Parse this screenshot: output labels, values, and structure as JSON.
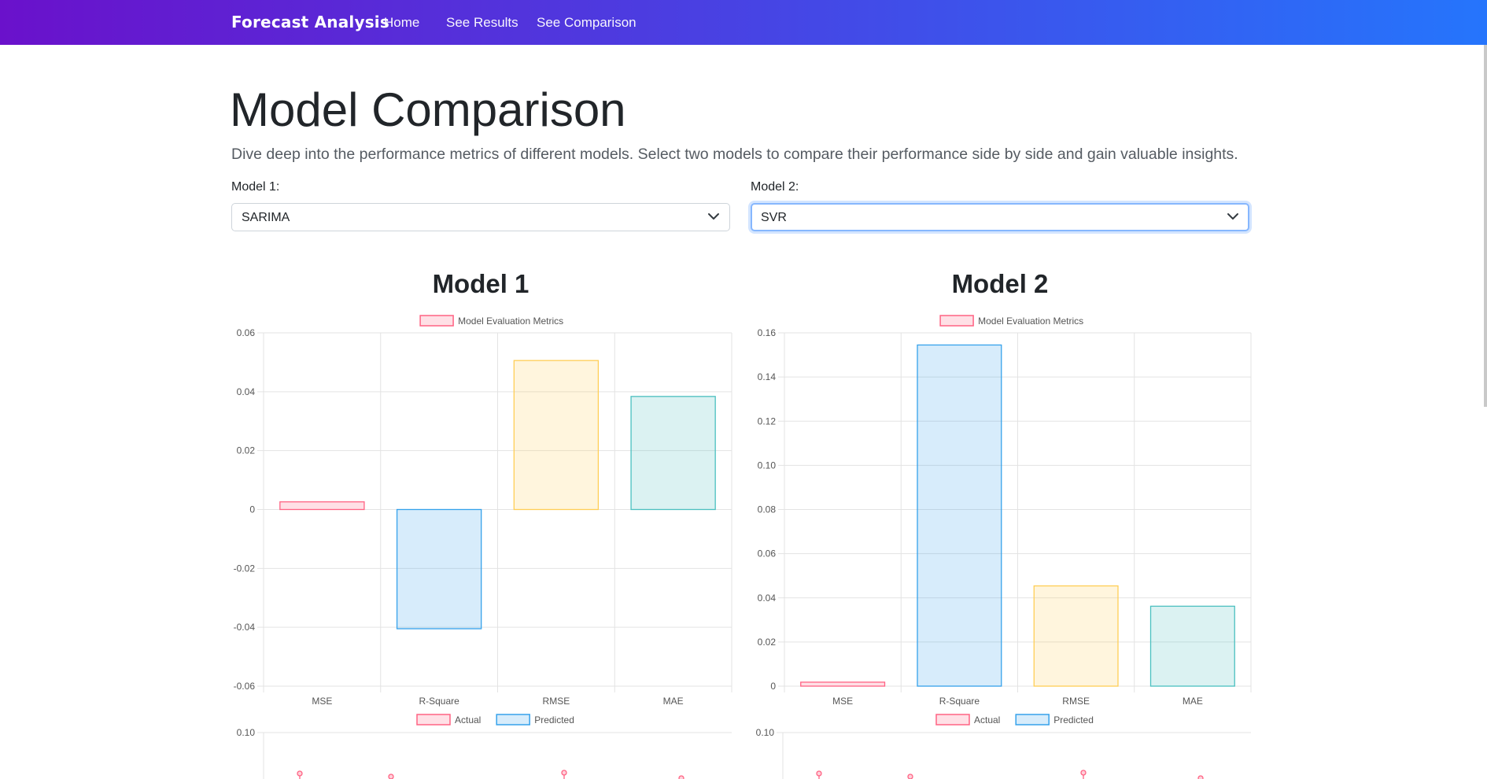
{
  "nav": {
    "brand": "Forecast Analysis",
    "links": [
      "Home",
      "See Results",
      "See Comparison"
    ]
  },
  "header": {
    "title": "Model Comparison",
    "lead": "Dive deep into the performance metrics of different models. Select two models to compare their performance side by side and gain valuable insights."
  },
  "form": {
    "model1_label": "Model 1:",
    "model1_value": "SARIMA",
    "model2_label": "Model 2:",
    "model2_value": "SVR"
  },
  "colors": {
    "nav_start": "#6a11cb",
    "nav_end": "#2575fc",
    "pink": "#ff6384",
    "blue": "#36a2eb",
    "yellow": "#ffce56",
    "teal": "#4bc0c0"
  },
  "chart_data": [
    {
      "type": "bar",
      "title": "Model 1",
      "legend": [
        "Model Evaluation Metrics"
      ],
      "legend_position": "top",
      "categories": [
        "MSE",
        "R-Square",
        "RMSE",
        "MAE"
      ],
      "values": [
        0.0026,
        -0.0405,
        0.0506,
        0.0384
      ],
      "ylim": [
        -0.06,
        0.06
      ],
      "yticks": [
        "0.06",
        "0.04",
        "0.02",
        "0",
        "-0.02",
        "-0.04",
        "-0.06"
      ],
      "grid": true
    },
    {
      "type": "bar",
      "title": "Model 2",
      "legend": [
        "Model Evaluation Metrics"
      ],
      "legend_position": "top",
      "categories": [
        "MSE",
        "R-Square",
        "RMSE",
        "MAE"
      ],
      "values": [
        0.0018,
        0.1545,
        0.0454,
        0.0362
      ],
      "ylim": [
        0,
        0.16
      ],
      "yticks": [
        "0.16",
        "0.14",
        "0.12",
        "0.10",
        "0.08",
        "0.06",
        "0.04",
        "0.02",
        "0"
      ],
      "grid": true
    },
    {
      "type": "scatter",
      "legend": [
        "Actual",
        "Predicted"
      ],
      "legend_position": "top",
      "yticks": [
        "0.10"
      ],
      "partially_visible": true
    },
    {
      "type": "scatter",
      "legend": [
        "Actual",
        "Predicted"
      ],
      "legend_position": "top",
      "yticks": [
        "0.10"
      ],
      "partially_visible": true
    }
  ]
}
